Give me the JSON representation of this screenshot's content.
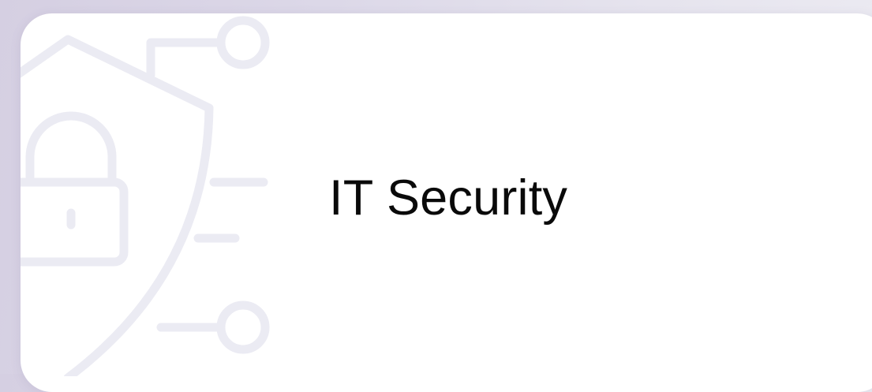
{
  "card": {
    "title": "IT Security",
    "icon": "shield-lock-circuit-icon",
    "icon_color": "#e9e9f2"
  }
}
